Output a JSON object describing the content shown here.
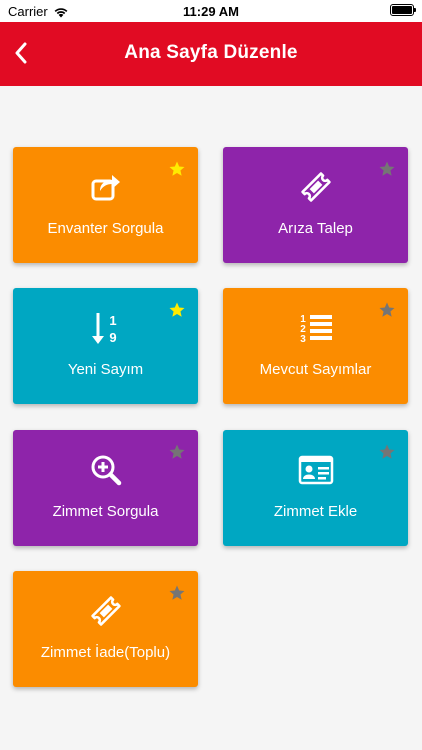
{
  "status_bar": {
    "carrier": "Carrier",
    "time": "11:29 AM"
  },
  "nav": {
    "title": "Ana Sayfa Düzenle"
  },
  "colors": {
    "orange": "#fb8c00",
    "purple": "#8e24aa",
    "teal": "#00a7c2",
    "star_on": "#ffeb00",
    "star_off": "#757575",
    "header": "#e10b23"
  },
  "tiles": [
    {
      "label": "Envanter Sorgula",
      "color": "#fb8c00",
      "icon": "share-icon",
      "favorite": true
    },
    {
      "label": "Arıza Talep",
      "color": "#8e24aa",
      "icon": "ticket-icon",
      "favorite": false
    },
    {
      "label": "Yeni Sayım",
      "color": "#00a7c2",
      "icon": "sort-numeric-icon",
      "favorite": true
    },
    {
      "label": "Mevcut Sayımlar",
      "color": "#fb8c00",
      "icon": "numbered-list-icon",
      "favorite": false
    },
    {
      "label": "Zimmet Sorgula",
      "color": "#8e24aa",
      "icon": "zoom-in-icon",
      "favorite": false
    },
    {
      "label": "Zimmet Ekle",
      "color": "#00a7c2",
      "icon": "id-card-icon",
      "favorite": false
    },
    {
      "label": "Zimmet İade(Toplu)",
      "color": "#fb8c00",
      "icon": "ticket-icon",
      "favorite": false
    }
  ]
}
